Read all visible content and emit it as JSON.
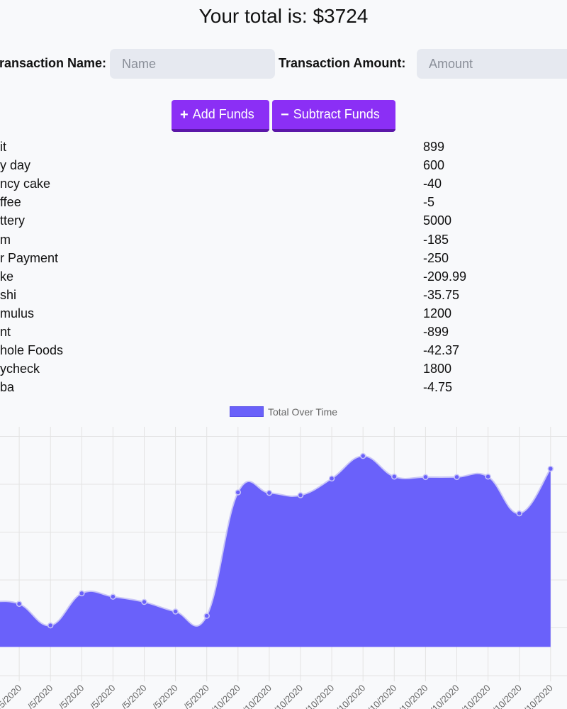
{
  "header": {
    "total_text": "Your total is: $3724"
  },
  "form": {
    "name_label": "Transaction Name:",
    "name_placeholder": "Name",
    "amount_label": "Transaction Amount:",
    "amount_placeholder": "Amount"
  },
  "buttons": {
    "add_icon": "+",
    "add_label": "Add Funds",
    "subtract_icon": "−",
    "subtract_label": "Subtract Funds"
  },
  "transactions": [
    {
      "name": "it",
      "amount": "899"
    },
    {
      "name": "y day",
      "amount": "600"
    },
    {
      "name": "ncy cake",
      "amount": "-40"
    },
    {
      "name": "ffee",
      "amount": "-5"
    },
    {
      "name": "ttery",
      "amount": "5000"
    },
    {
      "name": "m",
      "amount": "-185"
    },
    {
      "name": "r Payment",
      "amount": "-250"
    },
    {
      "name": "ke",
      "amount": "-209.99"
    },
    {
      "name": "shi",
      "amount": "-35.75"
    },
    {
      "name": "mulus",
      "amount": "1200"
    },
    {
      "name": "nt",
      "amount": "-899"
    },
    {
      "name": "hole Foods",
      "amount": "-42.37"
    },
    {
      "name": "ycheck",
      "amount": "1800"
    },
    {
      "name": "ba",
      "amount": "-4.75"
    }
  ],
  "chart_data": {
    "type": "area",
    "legend": "Total Over Time",
    "fill_color": "#6a61fa",
    "x": [
      "/2020",
      "/5/2020",
      "/5/2020",
      "/5/2020",
      "/5/2020",
      "/5/2020",
      "/5/2020",
      "/5/2020",
      "/10/2020",
      "/10/2020",
      "/10/2020",
      "/10/2020",
      "/10/2020",
      "/10/2020",
      "/10/2020",
      "/10/2020",
      "/10/2020",
      "/10/2020",
      "/10/2020"
    ],
    "values": [
      940,
      900,
      450,
      1120,
      1050,
      940,
      740,
      650,
      3230,
      3220,
      3170,
      3520,
      3990,
      3560,
      3550,
      3550,
      3560,
      2790,
      3724
    ],
    "y_min": -600,
    "y_max": 4600
  }
}
